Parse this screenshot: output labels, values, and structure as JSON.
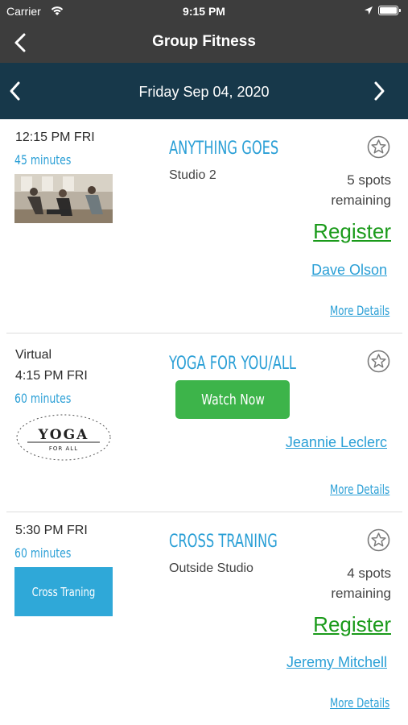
{
  "status_bar": {
    "carrier": "Carrier",
    "time": "9:15 PM"
  },
  "nav": {
    "title": "Group Fitness"
  },
  "date_bar": {
    "date": "Friday Sep 04, 2020"
  },
  "classes": [
    {
      "time": "12:15 PM FRI",
      "duration": "45 minutes",
      "name": "ANYTHING GOES",
      "room": "Studio 2",
      "spots_line1": "5 spots",
      "spots_line2": "remaining",
      "action": "Register",
      "instructor": "Dave Olson",
      "details": "More Details"
    },
    {
      "location": "Virtual",
      "time": "4:15 PM FRI",
      "duration": "60 minutes",
      "name": "YOGA FOR YOU/ALL",
      "action": "Watch Now",
      "instructor": "Jeannie Leclerc",
      "details": "More Details",
      "logo_text": "YOGA",
      "logo_subtext": "FOR ALL"
    },
    {
      "time": "5:30 PM FRI",
      "duration": "60 minutes",
      "name": "CROSS TRANING",
      "room": "Outside Studio",
      "spots_line1": "4 spots",
      "spots_line2": "remaining",
      "action": "Register",
      "instructor": "Jeremy Mitchell",
      "details": "More Details",
      "thumb_text": "Cross Traning"
    }
  ],
  "colors": {
    "header_bg": "#3d3d3d",
    "date_bar_bg": "#17384a",
    "accent_blue": "#2a9fd6",
    "register_green": "#1a9a1a",
    "watch_button_green": "#3db44a"
  }
}
